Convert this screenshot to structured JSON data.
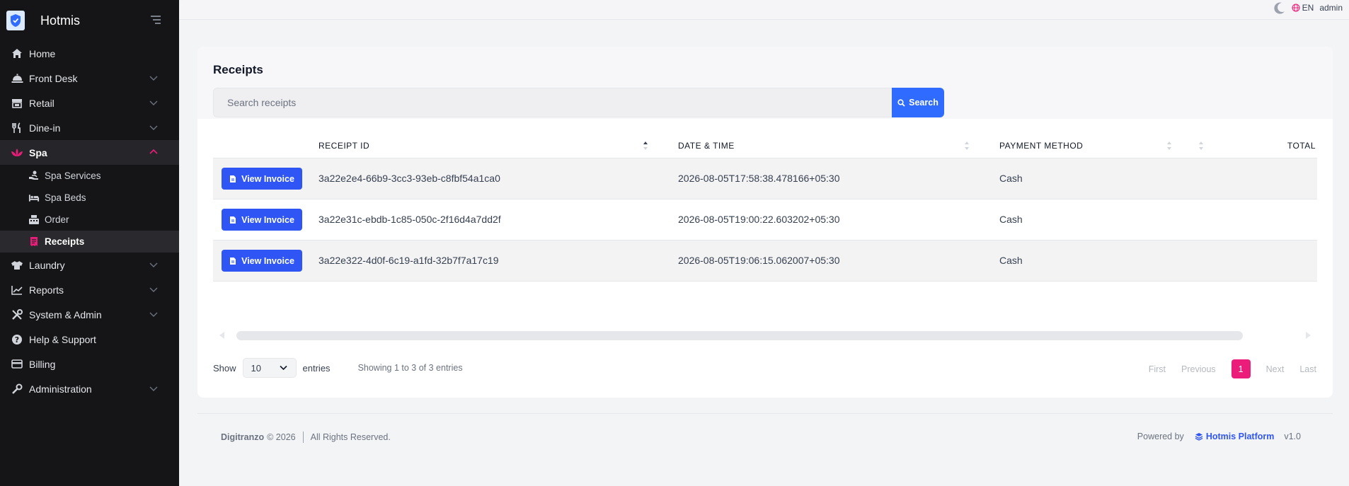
{
  "app": {
    "name": "Hotmis"
  },
  "colors": {
    "accent": "#2f56f5",
    "active_pink": "#ec1d7a",
    "sidebar_bg": "#151517"
  },
  "topbar": {
    "lang": "EN",
    "user": "admin"
  },
  "sidebar": {
    "items": [
      {
        "label": "Home",
        "icon": "home-icon"
      },
      {
        "label": "Front Desk",
        "icon": "bell-icon"
      },
      {
        "label": "Retail",
        "icon": "store-icon"
      },
      {
        "label": "Dine-in",
        "icon": "utensils-icon"
      },
      {
        "label": "Spa",
        "icon": "lotus-icon"
      },
      {
        "label": "Laundry",
        "icon": "shirt-icon"
      },
      {
        "label": "Reports",
        "icon": "chart-icon"
      },
      {
        "label": "System & Admin",
        "icon": "tools-icon"
      },
      {
        "label": "Help & Support",
        "icon": "help-icon"
      },
      {
        "label": "Billing",
        "icon": "card-icon"
      },
      {
        "label": "Administration",
        "icon": "wrench-icon"
      }
    ],
    "spa_sub": [
      {
        "label": "Spa Services",
        "icon": "hand-icon"
      },
      {
        "label": "Spa Beds",
        "icon": "bed-icon"
      },
      {
        "label": "Order",
        "icon": "register-icon"
      },
      {
        "label": "Receipts",
        "icon": "receipt-icon"
      }
    ]
  },
  "main": {
    "title": "Receipts",
    "search": {
      "placeholder": "Search receipts",
      "button_label": "Search"
    },
    "table": {
      "columns": [
        "RECEIPT ID",
        "DATE & TIME",
        "PAYMENT METHOD",
        "TOTAL"
      ],
      "action_label": "View Invoice",
      "rows": [
        {
          "id": "3a22e2e4-66b9-3cc3-93eb-c8fbf54a1ca0",
          "datetime": "2026-08-05T17:58:38.478166+05:30",
          "method": "Cash",
          "total": ""
        },
        {
          "id": "3a22e31c-ebdb-1c85-050c-2f16d4a7dd2f",
          "datetime": "2026-08-05T19:00:22.603202+05:30",
          "method": "Cash",
          "total": ""
        },
        {
          "id": "3a22e322-4d0f-6c19-a1fd-32b7f7a17c19",
          "datetime": "2026-08-05T19:06:15.062007+05:30",
          "method": "Cash",
          "total": ""
        }
      ]
    },
    "length": {
      "show_label": "Show",
      "value": "10",
      "entries_label": "entries"
    },
    "info": "Showing 1 to 3 of 3 entries",
    "pager": {
      "first": "First",
      "previous": "Previous",
      "current": "1",
      "next": "Next",
      "last": "Last"
    }
  },
  "footer": {
    "company": "Digitranzo",
    "year": "© 2026",
    "rights": "All Rights Reserved.",
    "powered_by": "Powered by",
    "platform": "Hotmis Platform",
    "version": "v1.0"
  }
}
